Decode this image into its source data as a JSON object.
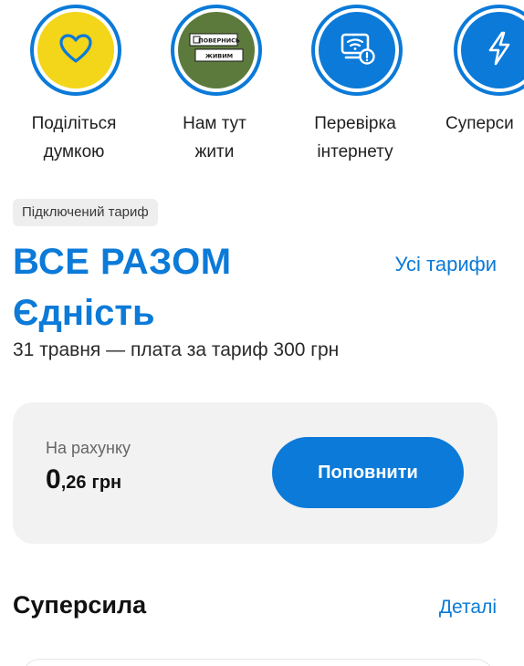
{
  "stories": [
    {
      "label": "Поділіться\nдумкою",
      "icon": "heart-icon",
      "ring_color": "#0b7ad8",
      "bg_color": "#f3d51a"
    },
    {
      "label": "Нам тут\nжити",
      "icon": "povernys-zhyvym-logo",
      "logo_text_1": "ПОВЕРНИСЬ",
      "logo_text_2": "ЖИВИМ",
      "ring_color": "#0b7ad8",
      "bg_color": "#5d7a3d"
    },
    {
      "label": "Перевірка\nінтернету",
      "icon": "wifi-check-icon",
      "ring_color": "#0b7ad8",
      "bg_color": "#0b7ad8"
    },
    {
      "label": "Суперси",
      "icon": "lightning-icon",
      "ring_color": "#0b7ad8",
      "bg_color": "#0b7ad8"
    }
  ],
  "tariff": {
    "badge": "Підключений тариф",
    "name": "ВСЕ РАЗОМ",
    "subname": "Єдність",
    "all_tariffs_link": "Усі тарифи",
    "info": "31 травня — плата за тариф 300 грн"
  },
  "balance": {
    "label": "На рахунку",
    "amount_int": "0",
    "amount_frac": ",26",
    "currency": "грн",
    "topup_label": "Поповнити"
  },
  "superpower": {
    "title": "Суперсила",
    "details_link": "Деталі"
  },
  "colors": {
    "accent": "#0b7ad8",
    "yellow": "#f3d51a",
    "military_green": "#5d7a3d",
    "card_bg": "#f2f2f2"
  }
}
